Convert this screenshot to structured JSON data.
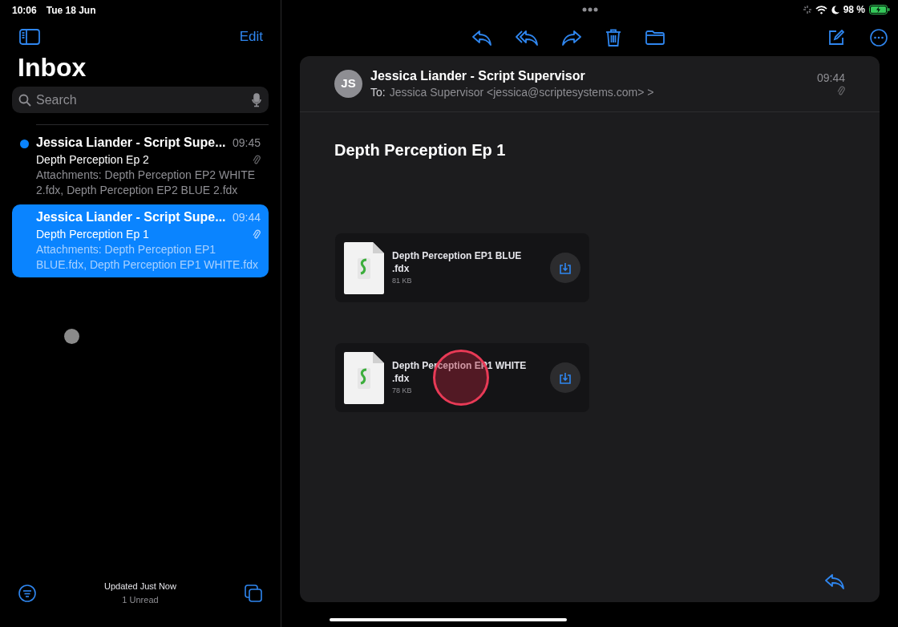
{
  "status_bar": {
    "time": "10:06",
    "date": "Tue 18 Jun",
    "battery": "98 %"
  },
  "sidebar": {
    "edit": "Edit",
    "title": "Inbox",
    "search": {
      "placeholder": "Search"
    },
    "messages": [
      {
        "sender": "Jessica Liander - Script Supe...",
        "time": "09:45",
        "subject": "Depth Perception Ep 2",
        "preview": "Attachments: Depth Perception EP2 WHITE 2.fdx, Depth Perception EP2 BLUE 2.fdx",
        "unread": true,
        "selected": false
      },
      {
        "sender": "Jessica Liander - Script Supe...",
        "time": "09:44",
        "subject": "Depth Perception Ep 1",
        "preview": "Attachments: Depth Perception EP1 BLUE.fdx, Depth Perception EP1 WHITE.fdx",
        "unread": false,
        "selected": true
      }
    ],
    "footer": {
      "status": "Updated Just Now",
      "unread": "1 Unread"
    }
  },
  "message": {
    "avatar": "JS",
    "sender": "Jessica Liander - Script Supervisor",
    "to_label": "To:",
    "to": "Jessica Supervisor <jessica@scriptesystems.com> >",
    "time": "09:44",
    "subject": "Depth Perception Ep 1",
    "attachments": [
      {
        "name": "Depth Perception EP1 BLUE\n.fdx",
        "size": "81 KB"
      },
      {
        "name": "Depth Perception EP1 WHITE\n.fdx",
        "size": "78 KB"
      }
    ]
  }
}
